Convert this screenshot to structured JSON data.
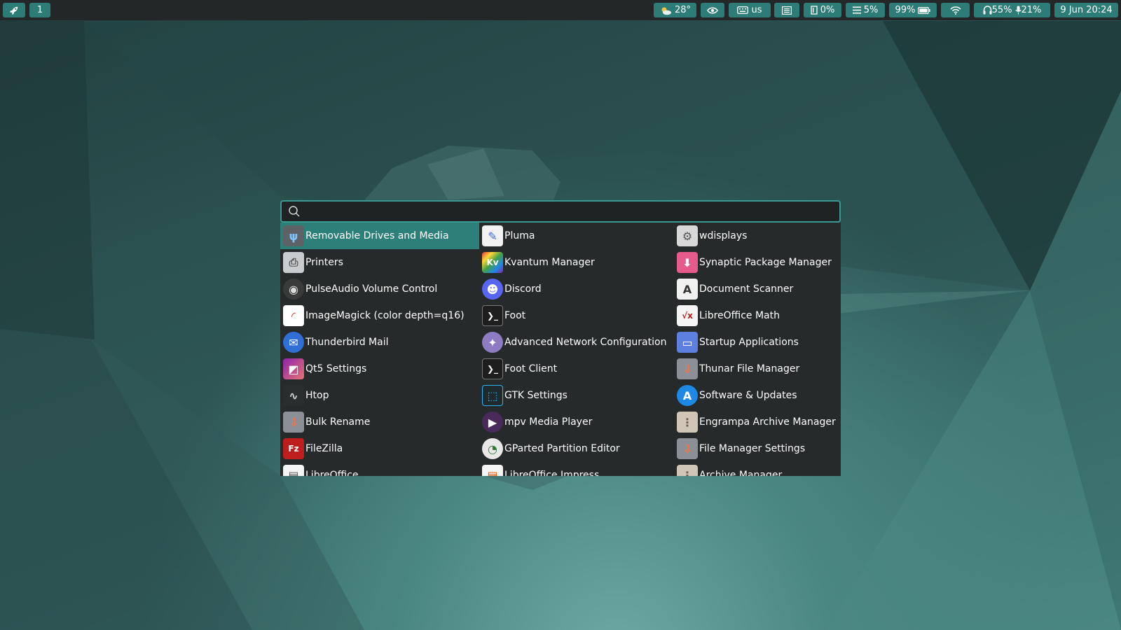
{
  "topbar": {
    "workspace": "1",
    "weather": "28°",
    "keyboard": "us",
    "memory": "0%",
    "cpu": "5%",
    "battery": "99%",
    "volume": "55%",
    "mic": "21%",
    "clock": "9 Jun 20:24"
  },
  "search": {
    "value": "",
    "placeholder": ""
  },
  "results": [
    {
      "label": "Removable Drives and Media",
      "icon": "usb-drive-icon",
      "selected": true
    },
    {
      "label": "Pluma",
      "icon": "pluma-icon"
    },
    {
      "label": "wdisplays",
      "icon": "gear-icon"
    },
    {
      "label": "Printers",
      "icon": "printer-icon"
    },
    {
      "label": "Kvantum Manager",
      "icon": "kvantum-icon"
    },
    {
      "label": "Synaptic Package Manager",
      "icon": "synaptic-icon"
    },
    {
      "label": "PulseAudio Volume Control",
      "icon": "speaker-icon"
    },
    {
      "label": "Discord",
      "icon": "discord-icon"
    },
    {
      "label": "Document Scanner",
      "icon": "scanner-icon"
    },
    {
      "label": "ImageMagick (color depth=q16)",
      "icon": "imagemagick-icon"
    },
    {
      "label": "Foot",
      "icon": "terminal-icon"
    },
    {
      "label": "LibreOffice Math",
      "icon": "libreoffice-math-icon"
    },
    {
      "label": "Thunderbird Mail",
      "icon": "thunderbird-icon"
    },
    {
      "label": "Advanced Network Configuration",
      "icon": "network-icon"
    },
    {
      "label": "Startup Applications",
      "icon": "startup-icon"
    },
    {
      "label": "Qt5 Settings",
      "icon": "qt5-settings-icon"
    },
    {
      "label": "Foot Client",
      "icon": "terminal-icon"
    },
    {
      "label": "Thunar File Manager",
      "icon": "file-manager-icon"
    },
    {
      "label": "Htop",
      "icon": "htop-icon"
    },
    {
      "label": "GTK Settings",
      "icon": "gtk-settings-icon"
    },
    {
      "label": "Software & Updates",
      "icon": "software-updates-icon"
    },
    {
      "label": "Bulk Rename",
      "icon": "bulk-rename-icon"
    },
    {
      "label": "mpv Media Player",
      "icon": "mpv-icon"
    },
    {
      "label": "Engrampa Archive Manager",
      "icon": "archive-icon"
    },
    {
      "label": "FileZilla",
      "icon": "filezilla-icon"
    },
    {
      "label": "GParted Partition Editor",
      "icon": "gparted-icon"
    },
    {
      "label": "File Manager Settings",
      "icon": "file-manager-icon"
    },
    {
      "label": "LibreOffice",
      "icon": "libreoffice-icon"
    },
    {
      "label": "LibreOffice Impress",
      "icon": "libreoffice-impress-icon"
    },
    {
      "label": "Archive Manager",
      "icon": "archive-icon"
    }
  ],
  "colors": {
    "accent": "#2d807a",
    "bar": "#232727",
    "panel": "#262a2a"
  }
}
